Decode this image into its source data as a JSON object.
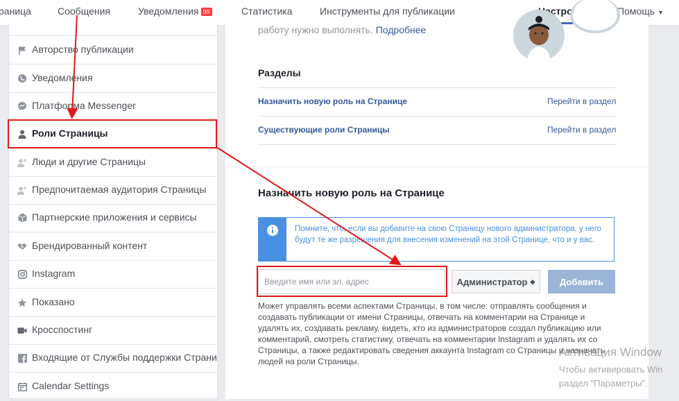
{
  "topnav": {
    "items": [
      {
        "label": "раница"
      },
      {
        "label": "Сообщения"
      },
      {
        "label": "Уведомления"
      },
      {
        "label": "Статистика"
      },
      {
        "label": "Инструменты для публикации"
      },
      {
        "label": "Настройки"
      },
      {
        "label": "Помощь"
      }
    ],
    "notifications_badge": "99"
  },
  "sidebar": {
    "items": [
      {
        "label": "Авторство публикации",
        "icon": "flag-icon"
      },
      {
        "label": "Уведомления",
        "icon": "globe-icon"
      },
      {
        "label": "Платформа Messenger",
        "icon": "messenger-icon"
      },
      {
        "label": "Роли Страницы",
        "icon": "person-icon"
      },
      {
        "label": "Люди и другие Страницы",
        "icon": "person-add-icon"
      },
      {
        "label": "Предпочитаемая аудитория Страницы",
        "icon": "person-star-icon"
      },
      {
        "label": "Партнерские приложения и сервисы",
        "icon": "cube-icon"
      },
      {
        "label": "Брендированный контент",
        "icon": "handshake-icon"
      },
      {
        "label": "Instagram",
        "icon": "instagram-icon"
      },
      {
        "label": "Показано",
        "icon": "star-icon"
      },
      {
        "label": "Кросспостинг",
        "icon": "video-camera-icon"
      },
      {
        "label": "Входящие от Службы поддержки Страни",
        "icon": "facebook-icon"
      },
      {
        "label": "Calendar Settings",
        "icon": "calendar-icon"
      }
    ]
  },
  "main": {
    "intro_text": "работу нужно выполнять.",
    "intro_link": "Подробнее",
    "sections_title": "Разделы",
    "sections": [
      {
        "label": "Назначить новую роль на Странице",
        "action": "Перейти в раздел"
      },
      {
        "label": "Существующие роли Страницы",
        "action": "Перейти в раздел"
      }
    ],
    "assign_title": "Назначить новую роль на Странице",
    "notice": "Помните, что, если вы добавите на свою Страницу нового администратора, у него будут те же разрешения для внесения изменений на этой Странице, что и у вас.",
    "input_placeholder": "Введите имя или эл. адрес",
    "role_select": "Администратор",
    "add_button": "Добавить",
    "role_description": "Может управлять всеми аспектами Страницы, в том числе: отправлять сообщения и создавать публикации от имени Страницы, отвечать на комментарии на Странице и удалять их, создавать рекламу, видеть, кто из администраторов создал публикацию или комментарий, смотреть статистику, отвечать на комментарии Instagram и удалять их со Страницы, а также редактировать сведения аккаунта Instagram со Страницы и назначать людей на роли Страницы."
  },
  "watermark": {
    "title": "Активация Window",
    "line1": "Чтобы активировать Win",
    "line2": "раздел \"Параметры\"."
  },
  "colors": {
    "accent": "#4267b2",
    "link": "#365899",
    "notice": "#4a90e2",
    "annotation": "#e0181b"
  }
}
